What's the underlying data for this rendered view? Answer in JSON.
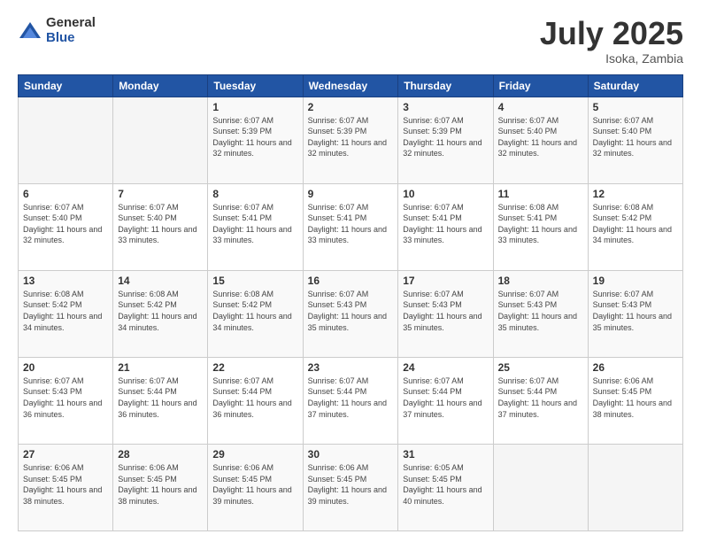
{
  "logo": {
    "general": "General",
    "blue": "Blue"
  },
  "header": {
    "month": "July 2025",
    "location": "Isoka, Zambia"
  },
  "weekdays": [
    "Sunday",
    "Monday",
    "Tuesday",
    "Wednesday",
    "Thursday",
    "Friday",
    "Saturday"
  ],
  "weeks": [
    [
      {
        "day": "",
        "sunrise": "",
        "sunset": "",
        "daylight": ""
      },
      {
        "day": "",
        "sunrise": "",
        "sunset": "",
        "daylight": ""
      },
      {
        "day": "1",
        "sunrise": "Sunrise: 6:07 AM",
        "sunset": "Sunset: 5:39 PM",
        "daylight": "Daylight: 11 hours and 32 minutes."
      },
      {
        "day": "2",
        "sunrise": "Sunrise: 6:07 AM",
        "sunset": "Sunset: 5:39 PM",
        "daylight": "Daylight: 11 hours and 32 minutes."
      },
      {
        "day": "3",
        "sunrise": "Sunrise: 6:07 AM",
        "sunset": "Sunset: 5:39 PM",
        "daylight": "Daylight: 11 hours and 32 minutes."
      },
      {
        "day": "4",
        "sunrise": "Sunrise: 6:07 AM",
        "sunset": "Sunset: 5:40 PM",
        "daylight": "Daylight: 11 hours and 32 minutes."
      },
      {
        "day": "5",
        "sunrise": "Sunrise: 6:07 AM",
        "sunset": "Sunset: 5:40 PM",
        "daylight": "Daylight: 11 hours and 32 minutes."
      }
    ],
    [
      {
        "day": "6",
        "sunrise": "Sunrise: 6:07 AM",
        "sunset": "Sunset: 5:40 PM",
        "daylight": "Daylight: 11 hours and 32 minutes."
      },
      {
        "day": "7",
        "sunrise": "Sunrise: 6:07 AM",
        "sunset": "Sunset: 5:40 PM",
        "daylight": "Daylight: 11 hours and 33 minutes."
      },
      {
        "day": "8",
        "sunrise": "Sunrise: 6:07 AM",
        "sunset": "Sunset: 5:41 PM",
        "daylight": "Daylight: 11 hours and 33 minutes."
      },
      {
        "day": "9",
        "sunrise": "Sunrise: 6:07 AM",
        "sunset": "Sunset: 5:41 PM",
        "daylight": "Daylight: 11 hours and 33 minutes."
      },
      {
        "day": "10",
        "sunrise": "Sunrise: 6:07 AM",
        "sunset": "Sunset: 5:41 PM",
        "daylight": "Daylight: 11 hours and 33 minutes."
      },
      {
        "day": "11",
        "sunrise": "Sunrise: 6:08 AM",
        "sunset": "Sunset: 5:41 PM",
        "daylight": "Daylight: 11 hours and 33 minutes."
      },
      {
        "day": "12",
        "sunrise": "Sunrise: 6:08 AM",
        "sunset": "Sunset: 5:42 PM",
        "daylight": "Daylight: 11 hours and 34 minutes."
      }
    ],
    [
      {
        "day": "13",
        "sunrise": "Sunrise: 6:08 AM",
        "sunset": "Sunset: 5:42 PM",
        "daylight": "Daylight: 11 hours and 34 minutes."
      },
      {
        "day": "14",
        "sunrise": "Sunrise: 6:08 AM",
        "sunset": "Sunset: 5:42 PM",
        "daylight": "Daylight: 11 hours and 34 minutes."
      },
      {
        "day": "15",
        "sunrise": "Sunrise: 6:08 AM",
        "sunset": "Sunset: 5:42 PM",
        "daylight": "Daylight: 11 hours and 34 minutes."
      },
      {
        "day": "16",
        "sunrise": "Sunrise: 6:07 AM",
        "sunset": "Sunset: 5:43 PM",
        "daylight": "Daylight: 11 hours and 35 minutes."
      },
      {
        "day": "17",
        "sunrise": "Sunrise: 6:07 AM",
        "sunset": "Sunset: 5:43 PM",
        "daylight": "Daylight: 11 hours and 35 minutes."
      },
      {
        "day": "18",
        "sunrise": "Sunrise: 6:07 AM",
        "sunset": "Sunset: 5:43 PM",
        "daylight": "Daylight: 11 hours and 35 minutes."
      },
      {
        "day": "19",
        "sunrise": "Sunrise: 6:07 AM",
        "sunset": "Sunset: 5:43 PM",
        "daylight": "Daylight: 11 hours and 35 minutes."
      }
    ],
    [
      {
        "day": "20",
        "sunrise": "Sunrise: 6:07 AM",
        "sunset": "Sunset: 5:43 PM",
        "daylight": "Daylight: 11 hours and 36 minutes."
      },
      {
        "day": "21",
        "sunrise": "Sunrise: 6:07 AM",
        "sunset": "Sunset: 5:44 PM",
        "daylight": "Daylight: 11 hours and 36 minutes."
      },
      {
        "day": "22",
        "sunrise": "Sunrise: 6:07 AM",
        "sunset": "Sunset: 5:44 PM",
        "daylight": "Daylight: 11 hours and 36 minutes."
      },
      {
        "day": "23",
        "sunrise": "Sunrise: 6:07 AM",
        "sunset": "Sunset: 5:44 PM",
        "daylight": "Daylight: 11 hours and 37 minutes."
      },
      {
        "day": "24",
        "sunrise": "Sunrise: 6:07 AM",
        "sunset": "Sunset: 5:44 PM",
        "daylight": "Daylight: 11 hours and 37 minutes."
      },
      {
        "day": "25",
        "sunrise": "Sunrise: 6:07 AM",
        "sunset": "Sunset: 5:44 PM",
        "daylight": "Daylight: 11 hours and 37 minutes."
      },
      {
        "day": "26",
        "sunrise": "Sunrise: 6:06 AM",
        "sunset": "Sunset: 5:45 PM",
        "daylight": "Daylight: 11 hours and 38 minutes."
      }
    ],
    [
      {
        "day": "27",
        "sunrise": "Sunrise: 6:06 AM",
        "sunset": "Sunset: 5:45 PM",
        "daylight": "Daylight: 11 hours and 38 minutes."
      },
      {
        "day": "28",
        "sunrise": "Sunrise: 6:06 AM",
        "sunset": "Sunset: 5:45 PM",
        "daylight": "Daylight: 11 hours and 38 minutes."
      },
      {
        "day": "29",
        "sunrise": "Sunrise: 6:06 AM",
        "sunset": "Sunset: 5:45 PM",
        "daylight": "Daylight: 11 hours and 39 minutes."
      },
      {
        "day": "30",
        "sunrise": "Sunrise: 6:06 AM",
        "sunset": "Sunset: 5:45 PM",
        "daylight": "Daylight: 11 hours and 39 minutes."
      },
      {
        "day": "31",
        "sunrise": "Sunrise: 6:05 AM",
        "sunset": "Sunset: 5:45 PM",
        "daylight": "Daylight: 11 hours and 40 minutes."
      },
      {
        "day": "",
        "sunrise": "",
        "sunset": "",
        "daylight": ""
      },
      {
        "day": "",
        "sunrise": "",
        "sunset": "",
        "daylight": ""
      }
    ]
  ]
}
